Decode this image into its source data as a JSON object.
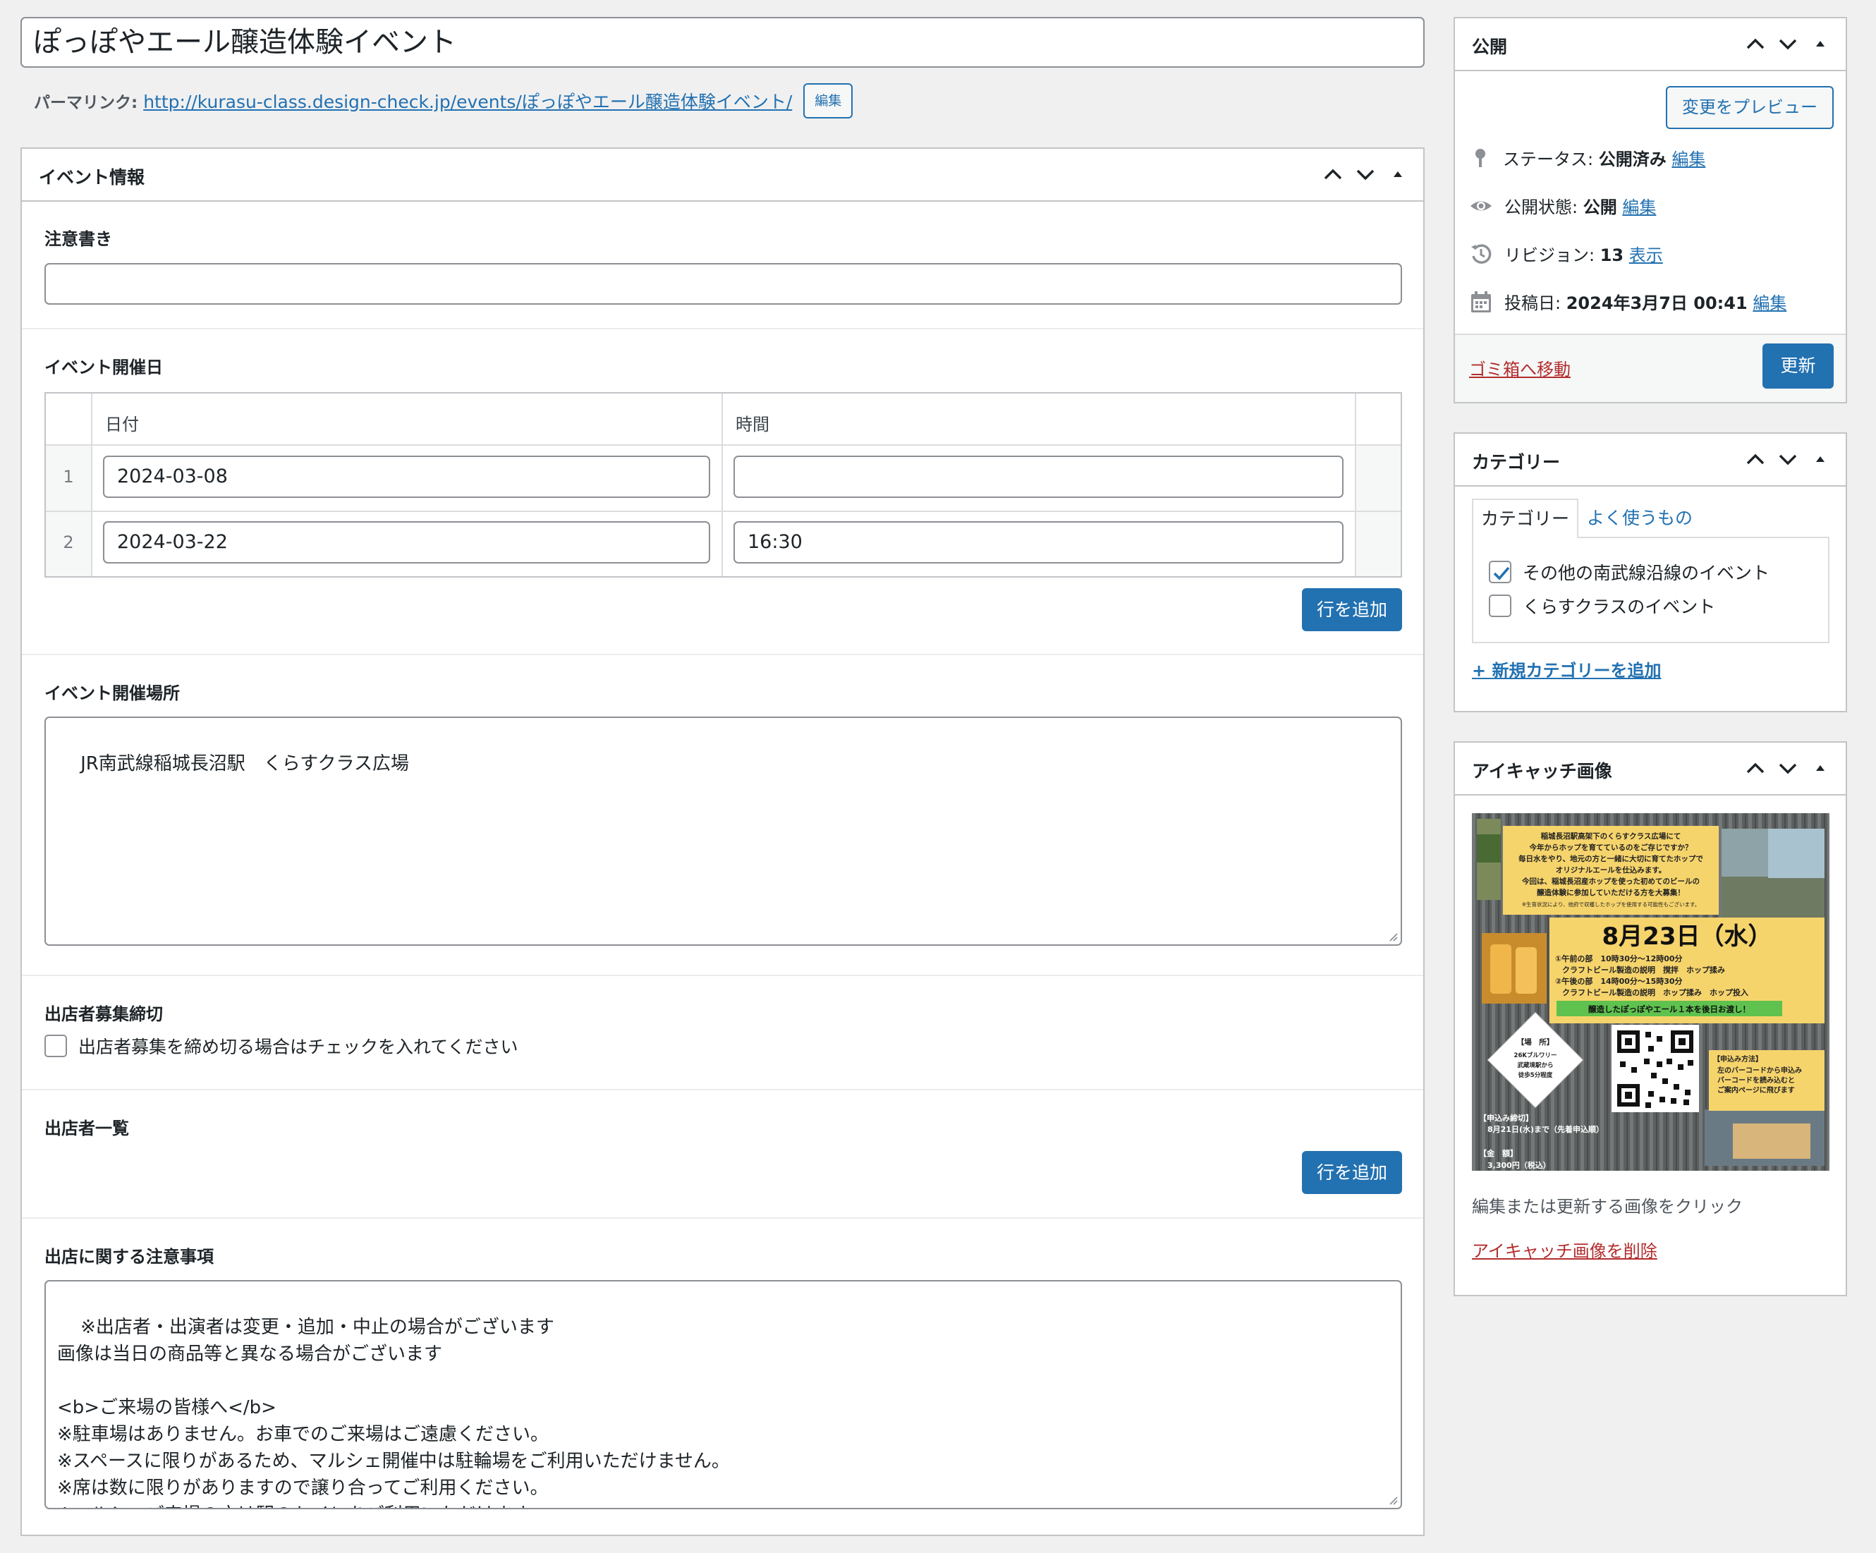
{
  "post": {
    "title": "ぽっぽやエール醸造体験イベント",
    "permalink_label": "パーマリンク:",
    "permalink_url": "http://kurasu-class.design-check.jp/events/ぽっぽやエール醸造体験イベント/",
    "permalink_edit": "編集"
  },
  "event_box": {
    "title": "イベント情報",
    "notice": {
      "label": "注意書き",
      "value": ""
    },
    "dates": {
      "label": "イベント開催日",
      "columns": [
        "日付",
        "時間"
      ],
      "rows": [
        {
          "num": "1",
          "date": "2024-03-08",
          "time": ""
        },
        {
          "num": "2",
          "date": "2024-03-22",
          "time": "16:30"
        }
      ],
      "add_row": "行を追加"
    },
    "venue": {
      "label": "イベント開催場所",
      "value": "JR南武線稲城長沼駅　くらすクラス広場"
    },
    "deadline": {
      "label": "出店者募集締切",
      "checkbox_label": "出店者募集を締め切る場合はチェックを入れてください",
      "checked": false
    },
    "vendors": {
      "label": "出店者一覧",
      "add_row": "行を追加"
    },
    "notes": {
      "label": "出店に関する注意事項",
      "value": "※出店者・出演者は変更・追加・中止の場合がございます\n画像は当日の商品等と異なる場合がございます\n\n<b>ご来場の皆様へ</b>\n※駐車場はありません。お車でのご来場はご遠慮ください。\n※スペースに限りがあるため、マルシェ開催中は駐輪場をご利用いただけません。\n※席は数に限りがありますので譲り合ってご利用ください。\n※マルシェご来場の方は駅のトイレをご利用いただけます。"
    }
  },
  "publish_box": {
    "title": "公開",
    "preview_button": "変更をプレビュー",
    "status_label": "ステータス:",
    "status_value": "公開済み",
    "status_edit": "編集",
    "visibility_label": "公開状態:",
    "visibility_value": "公開",
    "visibility_edit": "編集",
    "revisions_label": "リビジョン:",
    "revisions_value": "13",
    "revisions_link": "表示",
    "date_label": "投稿日:",
    "date_value": "2024年3月7日 00:41",
    "date_edit": "編集",
    "trash_link": "ゴミ箱へ移動",
    "update_button": "更新"
  },
  "category_box": {
    "title": "カテゴリー",
    "tabs": [
      "カテゴリー",
      "よく使うもの"
    ],
    "items": [
      {
        "label": "その他の南武線沿線のイベント",
        "checked": true
      },
      {
        "label": "くらすクラスのイベント",
        "checked": false
      }
    ],
    "add_link": "+ 新規カテゴリーを追加"
  },
  "image_box": {
    "title": "アイキャッチ画像",
    "hint": "編集または更新する画像をクリック",
    "remove_link": "アイキャッチ画像を削除",
    "poster": {
      "intro": [
        "稲城長沼駅高架下のくらすクラス広場にて",
        "今年からホップを育てているのをご存じですか？",
        "毎日水をやり、地元の方と一緒に大切に育てたホップで",
        "オリジナルエールを仕込みます。",
        "今回は、稲城長沼産ホップを使った初めてのビールの",
        "醸造体験に参加していただける方を大募集！"
      ],
      "intro_note": "※生育状況により、他府で収穫したホップを使用する可能性もございます。",
      "date": "8月23日（水）",
      "schedule": [
        "①午前の部　10時30分〜12時00分",
        "クラフトビール製造の説明　撹拌　ホップ揉み",
        "②午後の部　14時00分〜15時30分",
        "クラフトビール製造の説明　ホップ揉み　ホップ投入"
      ],
      "green_banner": "醸造したぽっぽやエール１本を後日お渡し！",
      "place_title": "【場　所】",
      "place_lines": [
        "26Kブルワリー",
        "武蔵境駅から",
        "徒歩5分程度"
      ],
      "apply_title": "【申込み方法】",
      "apply_lines": [
        "左のバーコードから申込み",
        "バーコードを読み込むと",
        "ご案内ページに飛びます"
      ],
      "deadline_title": "【申込み締切】",
      "deadline_line": "8月21日(水)まで（先着申込順）",
      "price_title": "【金　額】",
      "price_line": "3,300円（税込）"
    }
  }
}
